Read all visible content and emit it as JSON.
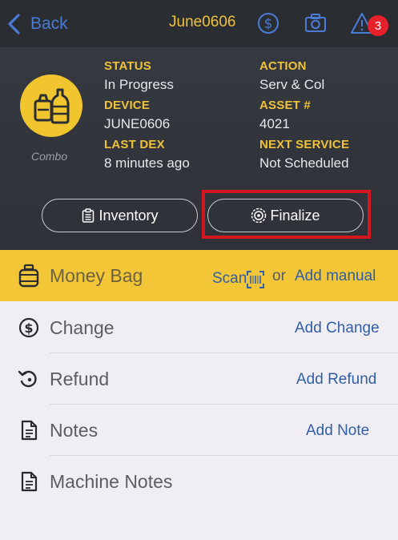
{
  "nav": {
    "back_label": "Back",
    "title": "June0606",
    "icons": [
      "dollar-circle-icon",
      "camera-icon",
      "warning-icon"
    ],
    "alert_count": "3"
  },
  "header": {
    "avatar_icon": "combo-bottles-icon",
    "avatar_label": "Combo",
    "fields": {
      "status_label": "STATUS",
      "status_value": "In Progress",
      "action_label": "ACTION",
      "action_value": "Serv & Col",
      "device_label": "DEVICE",
      "device_value": "JUNE0606",
      "asset_label": "ASSET #",
      "asset_value": "4021",
      "last_dex_label": "LAST DEX",
      "last_dex_value": "8 minutes ago",
      "next_service_label": "NEXT SERVICE",
      "next_service_value": "Not Scheduled"
    },
    "buttons": {
      "inventory": "Inventory",
      "finalize": "Finalize"
    }
  },
  "money_bag": {
    "label": "Money Bag",
    "scan_label": "Scan",
    "or_label": "or",
    "add_manual_label": "Add manual"
  },
  "rows": [
    {
      "label": "Change",
      "action": "Add Change",
      "icon": "dollar-circle-icon"
    },
    {
      "label": "Refund",
      "action": "Add Refund",
      "icon": "refund-arrow-icon"
    },
    {
      "label": "Notes",
      "action": "Add Note",
      "icon": "document-icon"
    },
    {
      "label": "Machine Notes",
      "action": "",
      "icon": "document-icon"
    }
  ],
  "colors": {
    "accent_yellow": "#f2c636",
    "link_blue": "#2f5fa8",
    "header_dark": "#2e3137",
    "highlight_red": "#d5161f",
    "badge_red": "#e8202a"
  }
}
